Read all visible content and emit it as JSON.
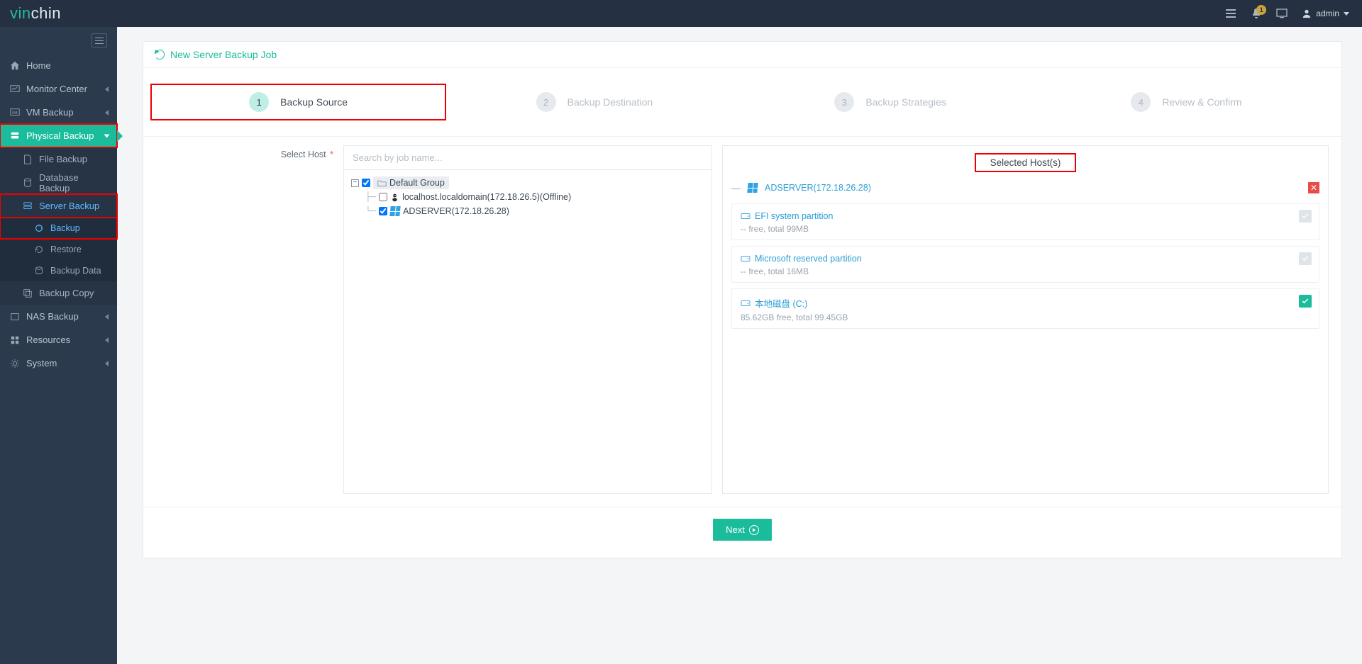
{
  "brand": {
    "part1": "vin",
    "part2": "chin"
  },
  "top": {
    "notif_count": "1",
    "user": "admin"
  },
  "nav": {
    "home": "Home",
    "monitor": "Monitor Center",
    "vmbackup": "VM Backup",
    "physical": "Physical Backup",
    "file": "File Backup",
    "database": "Database Backup",
    "server": "Server Backup",
    "backup": "Backup",
    "restore": "Restore",
    "backup_data": "Backup Data",
    "backup_copy": "Backup Copy",
    "nas": "NAS Backup",
    "resources": "Resources",
    "system": "System"
  },
  "page": {
    "title": "New Server Backup Job",
    "steps": {
      "s1": {
        "num": "1",
        "title": "Backup Source"
      },
      "s2": {
        "num": "2",
        "title": "Backup Destination"
      },
      "s3": {
        "num": "3",
        "title": "Backup Strategies"
      },
      "s4": {
        "num": "4",
        "title": "Review & Confirm"
      }
    },
    "select_host_label": "Select Host",
    "search_placeholder": "Search by job name...",
    "tree": {
      "group": "Default Group",
      "host1": "localhost.localdomain(172.18.26.5)(Offline)",
      "host2": "ADSERVER(172.18.26.28)"
    },
    "selected_hosts_title": "Selected Host(s)",
    "selected_host_name": "ADSERVER(172.18.26.28)",
    "parts": [
      {
        "name": "EFI system partition",
        "detail": "-- free, total 99MB",
        "checked": false
      },
      {
        "name": "Microsoft reserved partition",
        "detail": "-- free, total 16MB",
        "checked": false
      },
      {
        "name": "本地磁盘 (C:)",
        "detail": "85.62GB free, total 99.45GB",
        "checked": true
      }
    ],
    "next": "Next"
  }
}
